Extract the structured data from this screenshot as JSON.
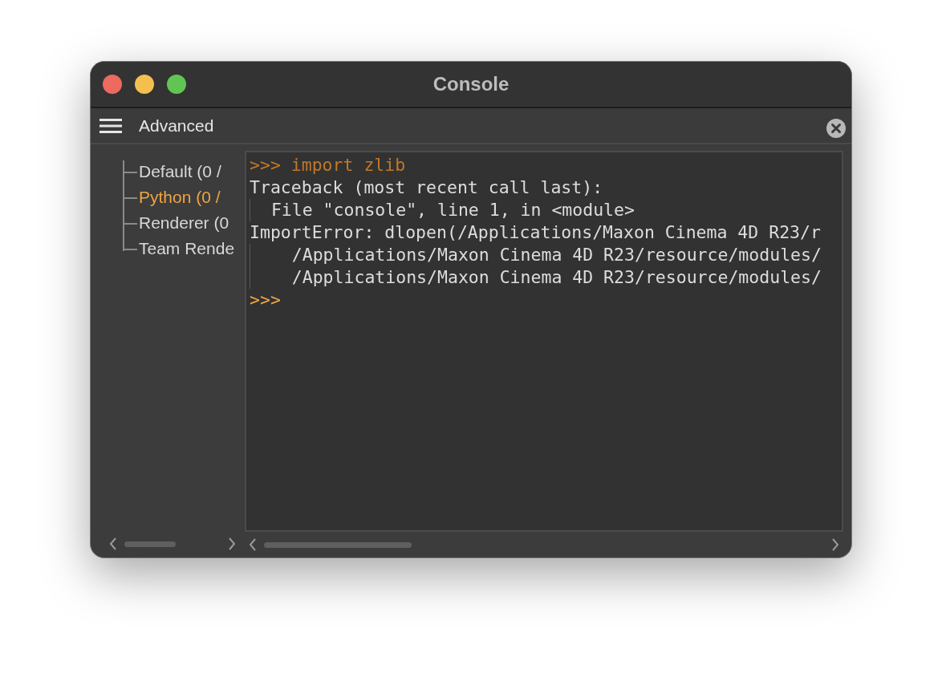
{
  "window": {
    "title": "Console"
  },
  "toolbar": {
    "label": "Advanced"
  },
  "tree": [
    {
      "label": "Default (0 /",
      "selected": false
    },
    {
      "label": "Python (0 /",
      "selected": true
    },
    {
      "label": "Renderer (0",
      "selected": false
    },
    {
      "label": "Team Rende",
      "selected": false
    }
  ],
  "console": {
    "lines": [
      {
        "kind": "input",
        "text": ">>> import zlib"
      },
      {
        "kind": "output",
        "text": "Traceback (most recent call last):"
      },
      {
        "kind": "continued",
        "text": "  File \"console\", line 1, in <module>"
      },
      {
        "kind": "output",
        "text": "ImportError: dlopen(/Applications/Maxon Cinema 4D R23/r"
      },
      {
        "kind": "continued",
        "text": "    /Applications/Maxon Cinema 4D R23/resource/modules/"
      },
      {
        "kind": "continued",
        "text": "    /Applications/Maxon Cinema 4D R23/resource/modules/"
      },
      {
        "kind": "prompt",
        "text": ">>>"
      }
    ]
  }
}
